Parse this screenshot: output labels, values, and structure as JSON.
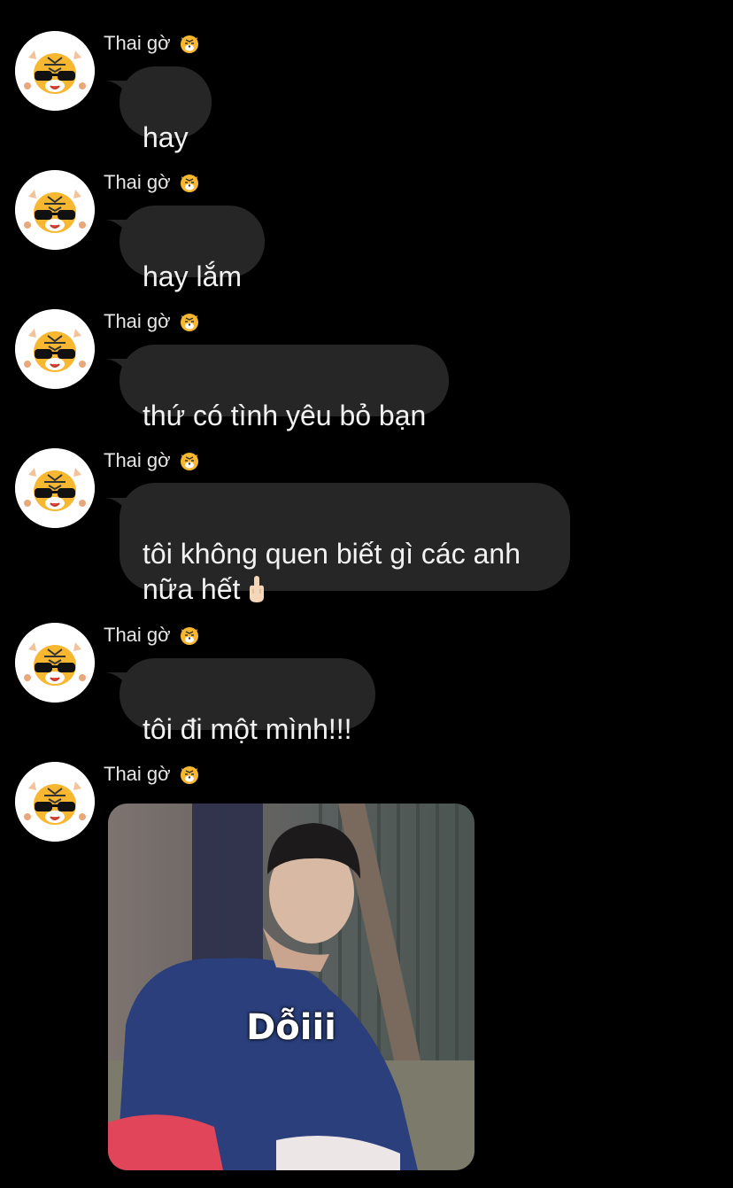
{
  "sender": {
    "name": "Thai gờ",
    "emoji": "tiger-face-icon"
  },
  "messages": [
    {
      "text": "hay"
    },
    {
      "text": "hay lắm"
    },
    {
      "text": "thứ có tình yêu bỏ bạn"
    },
    {
      "text": "tôi không quen biết gì các anh\nnữa hết",
      "trailing_icon": "middle-finger-emoji-icon"
    },
    {
      "text": "tôi đi một mình!!!"
    }
  ],
  "sticker": {
    "caption": "Dỗiii"
  },
  "colors": {
    "background": "#000000",
    "bubble": "#262626",
    "text": "#f2f2f2"
  }
}
